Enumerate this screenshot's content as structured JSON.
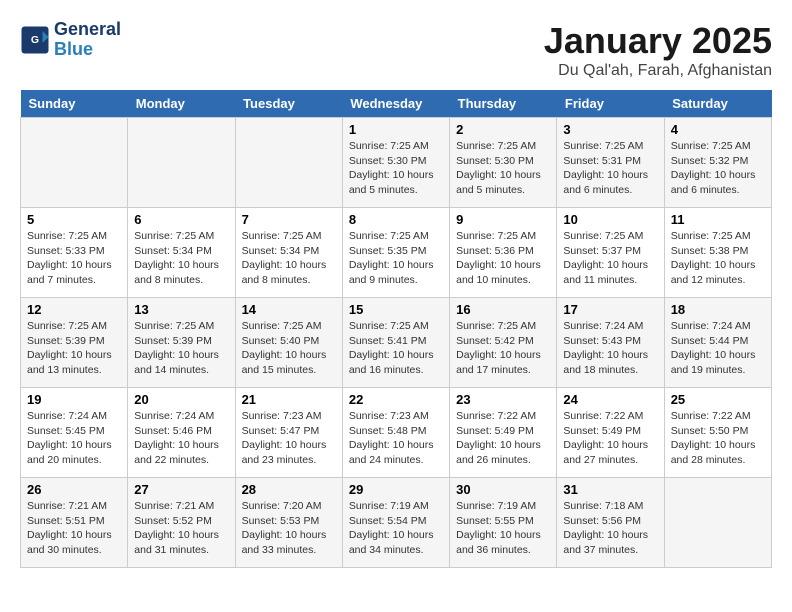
{
  "logo": {
    "line1": "General",
    "line2": "Blue"
  },
  "title": "January 2025",
  "subtitle": "Du Qal'ah, Farah, Afghanistan",
  "days_of_week": [
    "Sunday",
    "Monday",
    "Tuesday",
    "Wednesday",
    "Thursday",
    "Friday",
    "Saturday"
  ],
  "weeks": [
    [
      {
        "day": "",
        "info": ""
      },
      {
        "day": "",
        "info": ""
      },
      {
        "day": "",
        "info": ""
      },
      {
        "day": "1",
        "info": "Sunrise: 7:25 AM\nSunset: 5:30 PM\nDaylight: 10 hours\nand 5 minutes."
      },
      {
        "day": "2",
        "info": "Sunrise: 7:25 AM\nSunset: 5:30 PM\nDaylight: 10 hours\nand 5 minutes."
      },
      {
        "day": "3",
        "info": "Sunrise: 7:25 AM\nSunset: 5:31 PM\nDaylight: 10 hours\nand 6 minutes."
      },
      {
        "day": "4",
        "info": "Sunrise: 7:25 AM\nSunset: 5:32 PM\nDaylight: 10 hours\nand 6 minutes."
      }
    ],
    [
      {
        "day": "5",
        "info": "Sunrise: 7:25 AM\nSunset: 5:33 PM\nDaylight: 10 hours\nand 7 minutes."
      },
      {
        "day": "6",
        "info": "Sunrise: 7:25 AM\nSunset: 5:34 PM\nDaylight: 10 hours\nand 8 minutes."
      },
      {
        "day": "7",
        "info": "Sunrise: 7:25 AM\nSunset: 5:34 PM\nDaylight: 10 hours\nand 8 minutes."
      },
      {
        "day": "8",
        "info": "Sunrise: 7:25 AM\nSunset: 5:35 PM\nDaylight: 10 hours\nand 9 minutes."
      },
      {
        "day": "9",
        "info": "Sunrise: 7:25 AM\nSunset: 5:36 PM\nDaylight: 10 hours\nand 10 minutes."
      },
      {
        "day": "10",
        "info": "Sunrise: 7:25 AM\nSunset: 5:37 PM\nDaylight: 10 hours\nand 11 minutes."
      },
      {
        "day": "11",
        "info": "Sunrise: 7:25 AM\nSunset: 5:38 PM\nDaylight: 10 hours\nand 12 minutes."
      }
    ],
    [
      {
        "day": "12",
        "info": "Sunrise: 7:25 AM\nSunset: 5:39 PM\nDaylight: 10 hours\nand 13 minutes."
      },
      {
        "day": "13",
        "info": "Sunrise: 7:25 AM\nSunset: 5:39 PM\nDaylight: 10 hours\nand 14 minutes."
      },
      {
        "day": "14",
        "info": "Sunrise: 7:25 AM\nSunset: 5:40 PM\nDaylight: 10 hours\nand 15 minutes."
      },
      {
        "day": "15",
        "info": "Sunrise: 7:25 AM\nSunset: 5:41 PM\nDaylight: 10 hours\nand 16 minutes."
      },
      {
        "day": "16",
        "info": "Sunrise: 7:25 AM\nSunset: 5:42 PM\nDaylight: 10 hours\nand 17 minutes."
      },
      {
        "day": "17",
        "info": "Sunrise: 7:24 AM\nSunset: 5:43 PM\nDaylight: 10 hours\nand 18 minutes."
      },
      {
        "day": "18",
        "info": "Sunrise: 7:24 AM\nSunset: 5:44 PM\nDaylight: 10 hours\nand 19 minutes."
      }
    ],
    [
      {
        "day": "19",
        "info": "Sunrise: 7:24 AM\nSunset: 5:45 PM\nDaylight: 10 hours\nand 20 minutes."
      },
      {
        "day": "20",
        "info": "Sunrise: 7:24 AM\nSunset: 5:46 PM\nDaylight: 10 hours\nand 22 minutes."
      },
      {
        "day": "21",
        "info": "Sunrise: 7:23 AM\nSunset: 5:47 PM\nDaylight: 10 hours\nand 23 minutes."
      },
      {
        "day": "22",
        "info": "Sunrise: 7:23 AM\nSunset: 5:48 PM\nDaylight: 10 hours\nand 24 minutes."
      },
      {
        "day": "23",
        "info": "Sunrise: 7:22 AM\nSunset: 5:49 PM\nDaylight: 10 hours\nand 26 minutes."
      },
      {
        "day": "24",
        "info": "Sunrise: 7:22 AM\nSunset: 5:49 PM\nDaylight: 10 hours\nand 27 minutes."
      },
      {
        "day": "25",
        "info": "Sunrise: 7:22 AM\nSunset: 5:50 PM\nDaylight: 10 hours\nand 28 minutes."
      }
    ],
    [
      {
        "day": "26",
        "info": "Sunrise: 7:21 AM\nSunset: 5:51 PM\nDaylight: 10 hours\nand 30 minutes."
      },
      {
        "day": "27",
        "info": "Sunrise: 7:21 AM\nSunset: 5:52 PM\nDaylight: 10 hours\nand 31 minutes."
      },
      {
        "day": "28",
        "info": "Sunrise: 7:20 AM\nSunset: 5:53 PM\nDaylight: 10 hours\nand 33 minutes."
      },
      {
        "day": "29",
        "info": "Sunrise: 7:19 AM\nSunset: 5:54 PM\nDaylight: 10 hours\nand 34 minutes."
      },
      {
        "day": "30",
        "info": "Sunrise: 7:19 AM\nSunset: 5:55 PM\nDaylight: 10 hours\nand 36 minutes."
      },
      {
        "day": "31",
        "info": "Sunrise: 7:18 AM\nSunset: 5:56 PM\nDaylight: 10 hours\nand 37 minutes."
      },
      {
        "day": "",
        "info": ""
      }
    ]
  ]
}
